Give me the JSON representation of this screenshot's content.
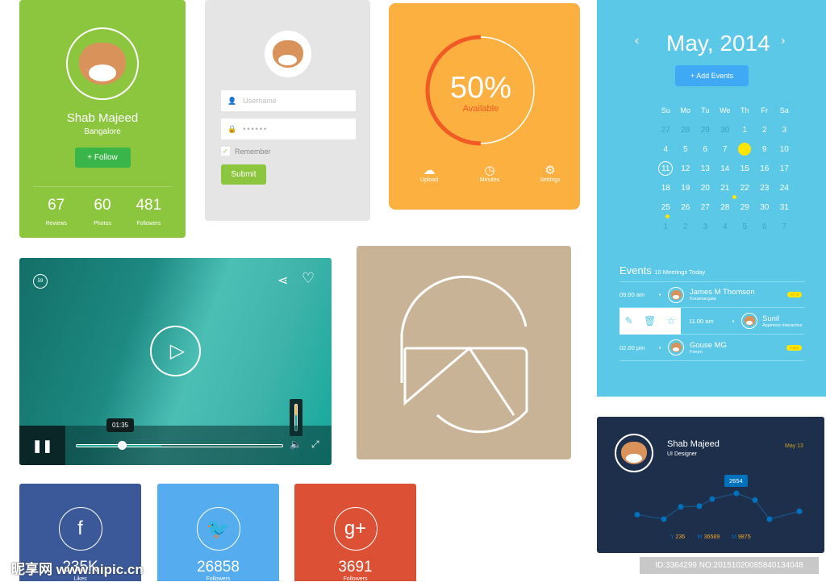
{
  "profile": {
    "name": "Shab Majeed",
    "location": "Bangalore",
    "follow_label": "Follow",
    "stats": [
      {
        "value": "67",
        "label": "Reviews"
      },
      {
        "value": "60",
        "label": "Photos"
      },
      {
        "value": "481",
        "label": "Followers"
      }
    ],
    "color": "#8cc63f"
  },
  "login": {
    "username_placeholder": "Username",
    "password_value": "••••••",
    "remember_label": "Remember",
    "submit_label": "Submit"
  },
  "progress": {
    "percent_label": "50%",
    "percent": 50,
    "status": "Available",
    "actions": [
      {
        "label": "Upload",
        "icon": "cloud-upload-icon"
      },
      {
        "label": "Minutes",
        "icon": "clock-icon"
      },
      {
        "label": "Settings",
        "icon": "gear-icon"
      }
    ],
    "color": "#fbb040"
  },
  "calendar": {
    "title": "May, 2014",
    "add_label": "Add Events",
    "weekdays": [
      "Su",
      "Mo",
      "Tu",
      "We",
      "Th",
      "Fr",
      "Sa"
    ],
    "days": [
      "27",
      "28",
      "29",
      "30",
      "1",
      "2",
      "3",
      "4",
      "5",
      "6",
      "7",
      "8",
      "9",
      "10",
      "11",
      "12",
      "13",
      "14",
      "15",
      "16",
      "17",
      "18",
      "19",
      "20",
      "21",
      "22",
      "23",
      "24",
      "25",
      "26",
      "27",
      "28",
      "29",
      "30",
      "31",
      "1",
      "2",
      "3",
      "4",
      "5",
      "6",
      "7"
    ],
    "selected": "11",
    "highlighted": "8",
    "events_title": "Events",
    "events_subtitle": "10 Meetings Today",
    "events": [
      {
        "time": "09.00 am",
        "name": "James M Thomson",
        "place": "Koramangala",
        "badge": "37 M"
      },
      {
        "time": "11.00 am",
        "name": "Sunil",
        "place": "Appiness Interactive"
      },
      {
        "time": "02.00 pm",
        "name": "Gouse MG",
        "place": "Forum",
        "badge": "5 Min"
      }
    ]
  },
  "video": {
    "counter": "59",
    "time_tooltip": "01:35",
    "progress_percent": 22,
    "buffered_percent": 41,
    "volume_percent": 60
  },
  "dashboard": {
    "name": "Shab Majeed",
    "role": "UI Designer",
    "date": "May 13",
    "tooltip": "2654",
    "stats": [
      {
        "key": "Y",
        "value": "236"
      },
      {
        "key": "W",
        "value": "36589"
      },
      {
        "key": "M",
        "value": "9875"
      }
    ]
  },
  "chart_data": {
    "type": "line",
    "values": [
      1700,
      1500,
      2050,
      2080,
      2400,
      2654,
      2350,
      1500,
      1850
    ],
    "annotations": [
      "2654"
    ]
  },
  "social": [
    {
      "icon": "facebook-icon",
      "value": "235K",
      "label": "Likes",
      "color": "#3b5998"
    },
    {
      "icon": "twitter-icon",
      "value": "26858",
      "label": "Followers",
      "color": "#55acee"
    },
    {
      "icon": "google-plus-icon",
      "value": "3691",
      "label": "Followers",
      "color": "#dc5136"
    }
  ],
  "watermark": {
    "site": "昵享网 www.nipic.cn",
    "id": "ID:3364299 NO:20151020085840134048"
  }
}
